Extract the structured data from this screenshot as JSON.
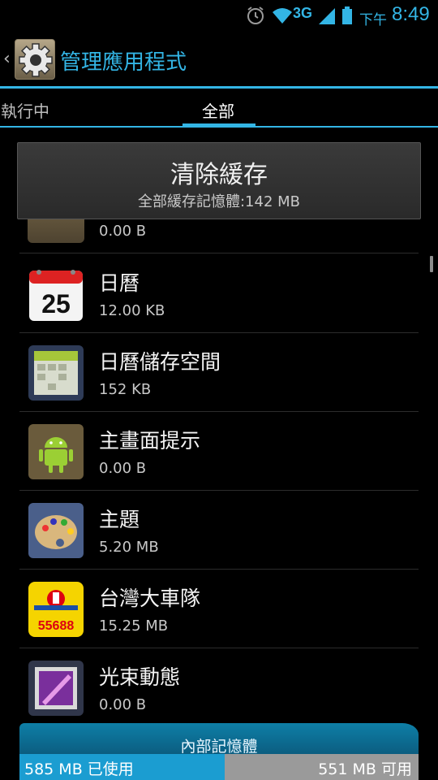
{
  "status_bar": {
    "network": "3G",
    "time_prefix": "下午",
    "time": "8:49",
    "icons": [
      "alarm-icon",
      "wifi-icon",
      "signal-icon",
      "battery-icon"
    ]
  },
  "header": {
    "title": "管理應用程式",
    "icon": "settings-gear-icon",
    "accent_color": "#33b5e5"
  },
  "tabs": [
    {
      "label": "執行中",
      "selected": false
    },
    {
      "label": "全部",
      "selected": true
    }
  ],
  "clear_cache": {
    "title": "清除緩存",
    "subtitle": "全部緩存記憶體:142 MB"
  },
  "apps": [
    {
      "name": "",
      "size": "0.00 B",
      "icon": "app-icon"
    },
    {
      "name": "日曆",
      "size": "12.00 KB",
      "icon": "calendar-icon",
      "icon_text": "25"
    },
    {
      "name": "日曆儲存空間",
      "size": "152 KB",
      "icon": "calendar-storage-icon"
    },
    {
      "name": "主畫面提示",
      "size": "0.00 B",
      "icon": "android-icon"
    },
    {
      "name": "主題",
      "size": "5.20 MB",
      "icon": "palette-icon"
    },
    {
      "name": "台灣大車隊",
      "size": "15.25 MB",
      "icon": "taxi-icon",
      "icon_text": "55688"
    },
    {
      "name": "光束動態",
      "size": "0.00 B",
      "icon": "light-beam-icon"
    }
  ],
  "storage": {
    "label": "內部記憶體",
    "used": "585 MB 已使用",
    "free": "551 MB 可用",
    "used_fraction": 0.515
  }
}
